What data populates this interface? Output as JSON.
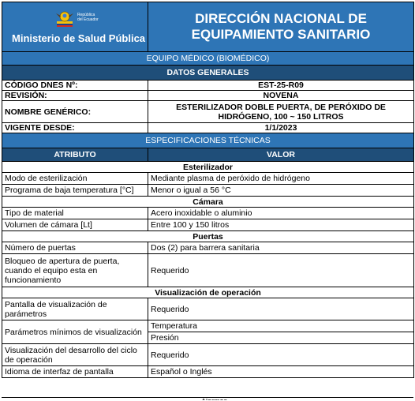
{
  "header": {
    "ministry": "Ministerio de Salud Pública",
    "republic_line1": "República",
    "republic_line2": "del Ecuador",
    "title_line1": "DIRECCIÓN NACIONAL DE",
    "title_line2": "EQUIPAMIENTO SANITARIO"
  },
  "category": "EQUIPO MÉDICO (BIOMÉDICO)",
  "general_title": "DATOS GENERALES",
  "general": {
    "code_label": "CÓDIGO DNES Nº:",
    "code_value": "EST-25-R09",
    "revision_label": "REVISIÓN:",
    "revision_value": "NOVENA",
    "name_label": "NOMBRE GENÉRICO:",
    "name_value": "ESTERILIZADOR DOBLE PUERTA, DE PERÓXIDO DE HIDRÓGENO, 100 ~ 150 LITROS",
    "valid_label": "VIGENTE DESDE:",
    "valid_value": "1/1/2023"
  },
  "specs_title": "ESPECIFICACIONES TÉCNICAS",
  "columns": {
    "attribute": "ATRIBUTO",
    "value": "VALOR"
  },
  "sections": {
    "s1": "Esterilizador",
    "s2": "Cámara",
    "s3": "Puertas",
    "s4": "Visualización de operación"
  },
  "rows": {
    "r1": {
      "attr": "Modo de esterilización",
      "val": "Mediante plasma de peróxido de hidrógeno"
    },
    "r2": {
      "attr": "Programa de baja temperatura [°C]",
      "val": "Menor o igual a 56 °C"
    },
    "r3": {
      "attr": "Tipo de material",
      "val": "Acero inoxidable o aluminio"
    },
    "r4": {
      "attr": "Volumen de cámara [Lt]",
      "val": "Entre 100 y 150  litros"
    },
    "r5": {
      "attr": "Número de puertas",
      "val": "Dos (2) para barrera sanitaria"
    },
    "r6": {
      "attr": "Bloqueo de apertura de puerta, cuando el equipo esta en funcionamiento",
      "val": "Requerido"
    },
    "r7": {
      "attr": "Pantalla de visualización de parámetros",
      "val": "Requerido"
    },
    "r8": {
      "attr": "Parámetros mínimos de visualización",
      "val1": "Temperatura",
      "val2": "Presión"
    },
    "r9": {
      "attr": "Visualización del desarrollo del ciclo de operación",
      "val": "Requerido"
    },
    "r10": {
      "attr": "Idioma de interfaz de pantalla",
      "val": "Español o Inglés"
    }
  },
  "partial_row_text": "Alarmas"
}
